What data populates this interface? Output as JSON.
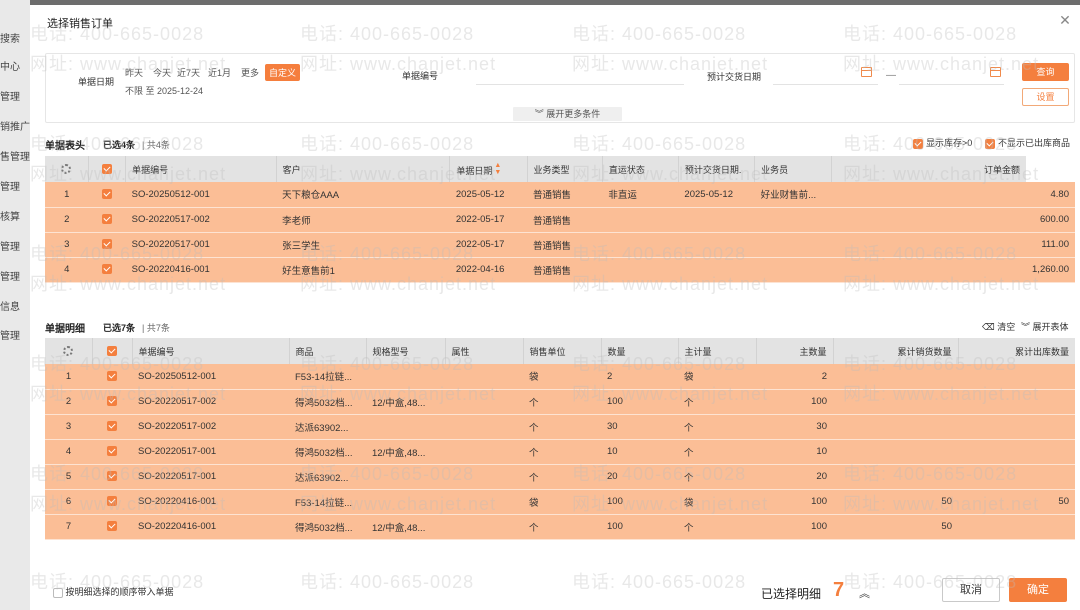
{
  "background_nav": [
    "搜索",
    "中心",
    "管理",
    "销推广",
    "售管理",
    "管理",
    "核算",
    "管理",
    "管理",
    "信息",
    "管理"
  ],
  "modal": {
    "title": "选择销售订单"
  },
  "filter": {
    "doc_date_label": "单据日期",
    "date_options": [
      "昨天",
      "今天",
      "近7天",
      "近1月",
      "更多"
    ],
    "custom_label": "自定义",
    "date_range": "不限 至 2025-12-24",
    "doc_no_label": "单据编号",
    "delivery_date_label": "预计交货日期",
    "range_dash": "—",
    "query_label": "查询",
    "settings_label": "设置",
    "expand_label": "展开更多条件"
  },
  "header_section": {
    "title": "单据表头",
    "selected": "已选4条",
    "total": "| 共4条",
    "options": [
      "显示库存>0",
      "不显示已出库商品"
    ],
    "columns": [
      "单据编号",
      "客户",
      "单据日期",
      "业务类型",
      "直运状态",
      "预计交货日期.",
      "业务员",
      "订单金额"
    ],
    "rows": [
      {
        "idx": "1",
        "no": "SO-20250512-001",
        "customer": "天下粮仓AAA",
        "date": "2025-05-12",
        "type": "普通销售",
        "direct": "非直运",
        "delivery": "2025-05-12",
        "sales": "好业财售前...",
        "amount": "4.80"
      },
      {
        "idx": "2",
        "no": "SO-20220517-002",
        "customer": "李老师",
        "date": "2022-05-17",
        "type": "普通销售",
        "direct": "",
        "delivery": "",
        "sales": "",
        "amount": "600.00"
      },
      {
        "idx": "3",
        "no": "SO-20220517-001",
        "customer": "张三学生",
        "date": "2022-05-17",
        "type": "普通销售",
        "direct": "",
        "delivery": "",
        "sales": "",
        "amount": "111.00"
      },
      {
        "idx": "4",
        "no": "SO-20220416-001",
        "customer": "好生意售前1",
        "date": "2022-04-16",
        "type": "普通销售",
        "direct": "",
        "delivery": "",
        "sales": "",
        "amount": "1,260.00"
      }
    ]
  },
  "detail_section": {
    "title": "单据明细",
    "selected": "已选7条",
    "total": "| 共7条",
    "clear_label": "清空",
    "expand_label": "展开表体",
    "columns": [
      "单据编号",
      "商品",
      "规格型号",
      "属性",
      "销售单位",
      "数量",
      "主计量",
      "主数量",
      "累计销货数量",
      "累计出库数量"
    ],
    "rows": [
      {
        "idx": "1",
        "no": "SO-20250512-001",
        "product": "F53-14拉链...",
        "spec": "",
        "attr": "",
        "unit": "袋",
        "qty": "2",
        "main_unit": "袋",
        "main_qty": "2",
        "cum_sales": "",
        "cum_out": ""
      },
      {
        "idx": "2",
        "no": "SO-20220517-002",
        "product": "得鸿5032档...",
        "spec": "12/中盒,48...",
        "attr": "",
        "unit": "个",
        "qty": "100",
        "main_unit": "个",
        "main_qty": "100",
        "cum_sales": "",
        "cum_out": ""
      },
      {
        "idx": "3",
        "no": "SO-20220517-002",
        "product": "达派63902...",
        "spec": "",
        "attr": "",
        "unit": "个",
        "qty": "30",
        "main_unit": "个",
        "main_qty": "30",
        "cum_sales": "",
        "cum_out": ""
      },
      {
        "idx": "4",
        "no": "SO-20220517-001",
        "product": "得鸿5032档...",
        "spec": "12/中盒,48...",
        "attr": "",
        "unit": "个",
        "qty": "10",
        "main_unit": "个",
        "main_qty": "10",
        "cum_sales": "",
        "cum_out": ""
      },
      {
        "idx": "5",
        "no": "SO-20220517-001",
        "product": "达派63902...",
        "spec": "",
        "attr": "",
        "unit": "个",
        "qty": "20",
        "main_unit": "个",
        "main_qty": "20",
        "cum_sales": "",
        "cum_out": ""
      },
      {
        "idx": "6",
        "no": "SO-20220416-001",
        "product": "F53-14拉链...",
        "spec": "",
        "attr": "",
        "unit": "袋",
        "qty": "100",
        "main_unit": "袋",
        "main_qty": "100",
        "cum_sales": "50",
        "cum_out": "50"
      },
      {
        "idx": "7",
        "no": "SO-20220416-001",
        "product": "得鸿5032档...",
        "spec": "12/中盒,48...",
        "attr": "",
        "unit": "个",
        "qty": "100",
        "main_unit": "个",
        "main_qty": "100",
        "cum_sales": "50",
        "cum_out": ""
      }
    ]
  },
  "footer": {
    "order_label": "按明细选择的顺序带入单据",
    "selected_label": "已选择明细",
    "selected_count": "7",
    "cancel_label": "取消",
    "confirm_label": "确定"
  },
  "watermark": {
    "phone": "电话: 400-665-0028",
    "site": "网址: www.chanjet.net"
  },
  "colors": {
    "accent": "#f47f3e",
    "row_selected": "#fbbe96",
    "header_bg": "#e3e3e3"
  }
}
